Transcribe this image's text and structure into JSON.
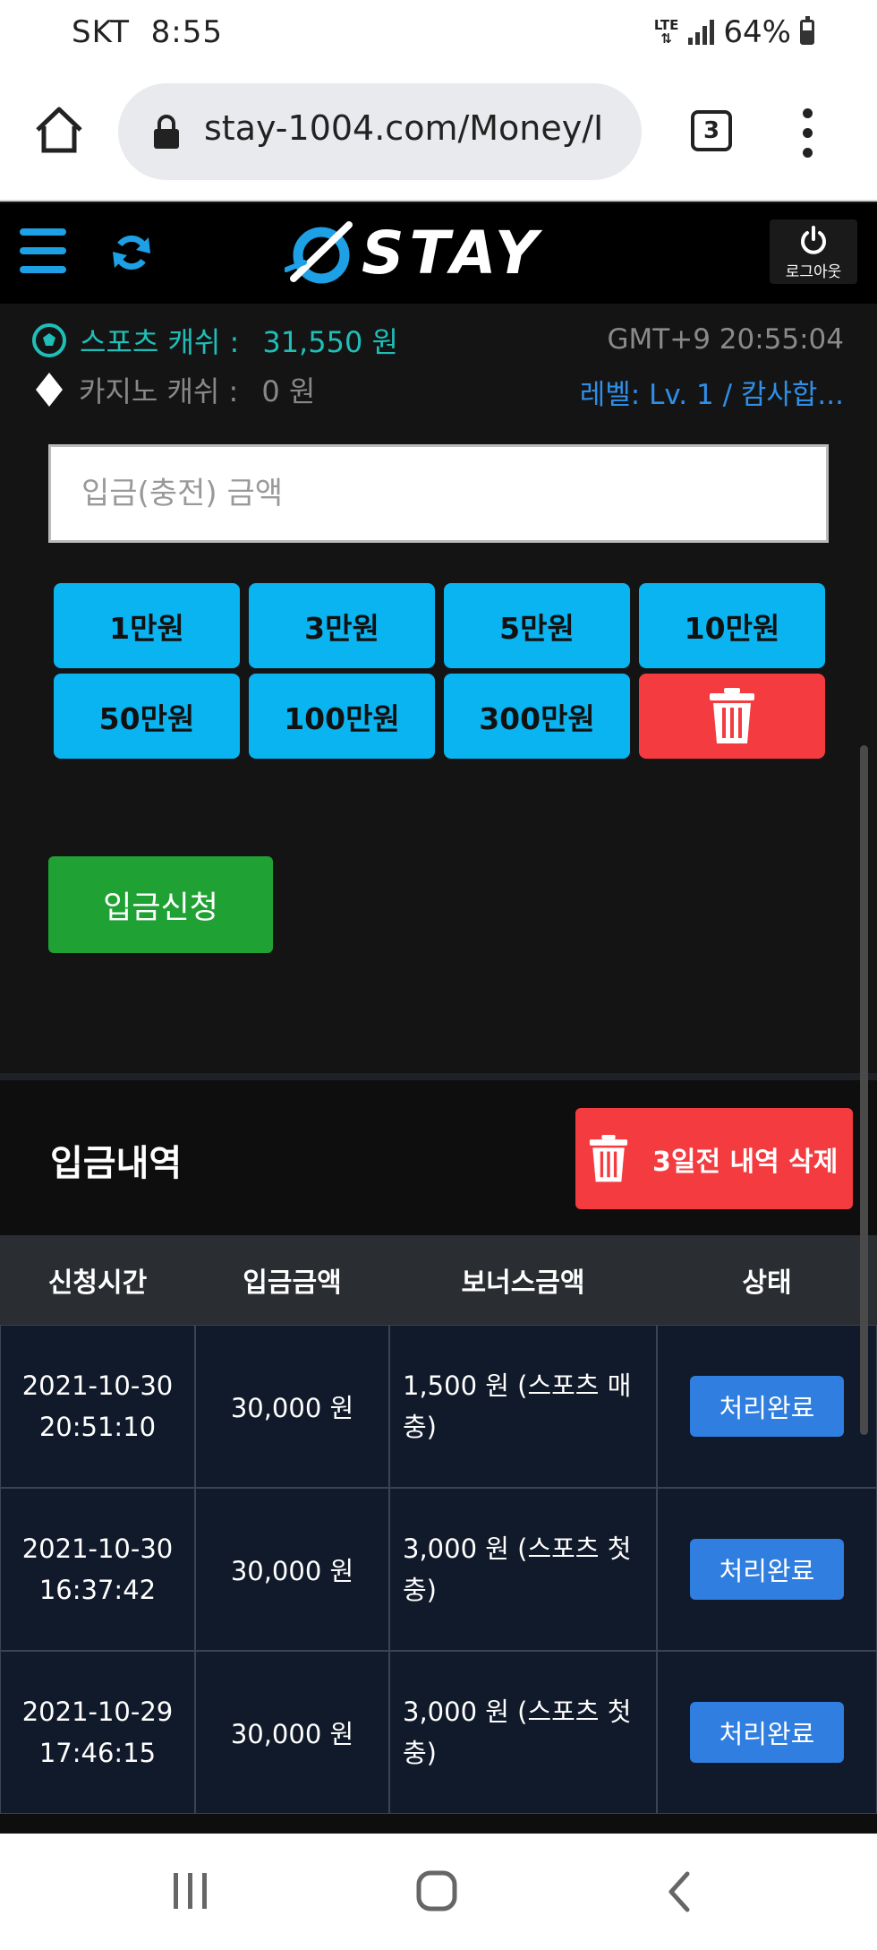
{
  "statusbar": {
    "carrier": "SKT",
    "time": "8:55",
    "network": "LTE",
    "battery": "64%"
  },
  "browser": {
    "url": "stay-1004.com/Money/I",
    "tab_count": "3"
  },
  "header": {
    "logo_text": "STAY",
    "logout_label": "로그아웃",
    "accent": "#1ea0e6"
  },
  "info": {
    "sports_label": "스포츠 캐쉬 :",
    "sports_value": "31,550 원",
    "casino_label": "카지노 캐쉬 :",
    "casino_value": "0 원",
    "clock": "GMT+9 20:55:04",
    "level": "레벨: Lv. 1 / 캄사합..."
  },
  "deposit": {
    "placeholder": "입금(충전) 금액",
    "quick_amounts": [
      "1만원",
      "3만원",
      "5만원",
      "10만원",
      "50만원",
      "100만원",
      "300만원"
    ],
    "apply_label": "입금신청"
  },
  "history": {
    "title": "입금내역",
    "delete_label": "3일전 내역 삭제",
    "columns": [
      "신청시간",
      "입금금액",
      "보너스금액",
      "상태"
    ],
    "rows": [
      {
        "date": "2021-10-30",
        "time": "20:51:10",
        "amount": "30,000 원",
        "bonus": "1,500 원 (스포츠 매충)",
        "status": "처리완료"
      },
      {
        "date": "2021-10-30",
        "time": "16:37:42",
        "amount": "30,000 원",
        "bonus": "3,000 원 (스포츠 첫충)",
        "status": "처리완료"
      },
      {
        "date": "2021-10-29",
        "time": "17:46:15",
        "amount": "30,000 원",
        "bonus": "3,000 원 (스포츠 첫충)",
        "status": "처리완료"
      }
    ]
  }
}
